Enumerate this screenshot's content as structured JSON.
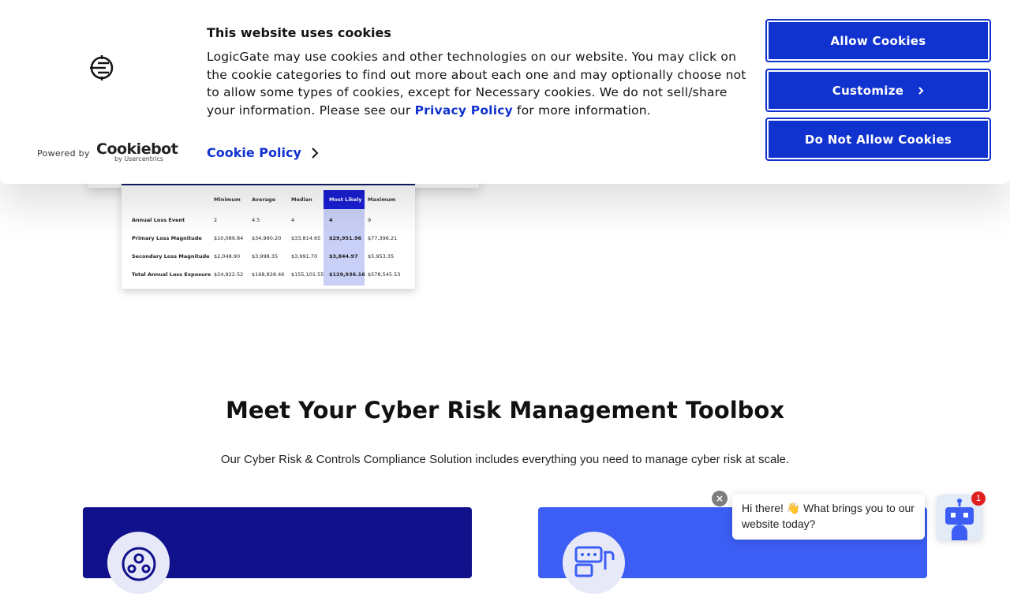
{
  "banner": {
    "title": "This website uses cookies",
    "text_pre": "LogicGate may use cookies and other technologies on our website. You may click on the cookie categories to find out more about each one and may optionally choose not to allow some types of cookies, except for Necessary cookies.  We do not sell/share your information. Please see our ",
    "privacy_link": "Privacy Policy",
    "text_post": " for more information.",
    "cookie_policy_link": "Cookie Policy",
    "powered_by": "Powered by",
    "cookiebot_name": "Cookiebot",
    "cookiebot_sub": "by Usercentrics",
    "buttons": {
      "allow": "Allow Cookies",
      "customize": "Customize",
      "deny": "Do Not Allow Cookies"
    },
    "accent_color": "#1032cf"
  },
  "table": {
    "headers": [
      "Minimum",
      "Average",
      "Median",
      "Most Likely",
      "Maximum"
    ],
    "rows": [
      {
        "label": "Annual Loss Event",
        "values": [
          "2",
          "4.5",
          "4",
          "4",
          "9"
        ]
      },
      {
        "label": "Primary Loss Magnitude",
        "values": [
          "$10,089.84",
          "$34,990.20",
          "$33,814.65",
          "$29,951.96",
          "$77,396.21"
        ]
      },
      {
        "label": "Secondary Loss Magnitude",
        "values": [
          "$2,048.90",
          "$3,998.35",
          "$3,991.70",
          "$3,844.97",
          "$5,953.35"
        ]
      },
      {
        "label": "Total Annual Loss Exposure",
        "values": [
          "$24,922.52",
          "$168,828.46",
          "$155,101.55",
          "$129,936.16",
          "$578,545.53"
        ]
      }
    ]
  },
  "section": {
    "title": "Meet Your Cyber Risk Management Toolbox",
    "subtitle": "Our Cyber Risk & Controls Compliance Solution includes everything you need to manage cyber risk at scale."
  },
  "chat": {
    "message": "Hi there! 👋 What brings you to our website today?",
    "badge_count": "1",
    "close_glyph": "×"
  }
}
